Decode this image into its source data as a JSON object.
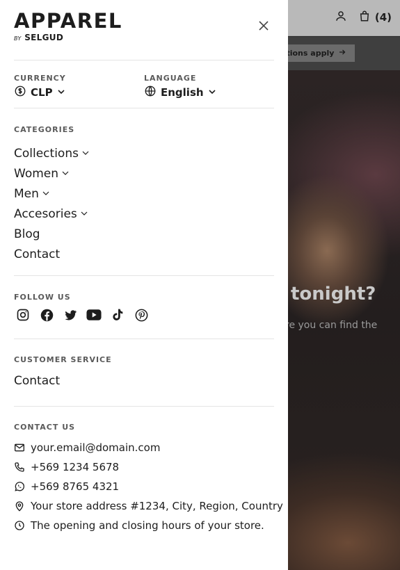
{
  "brand": {
    "name": "APPAREL",
    "by": "BY",
    "sub": "SELGUD"
  },
  "background": {
    "cart_count": "(4)",
    "promo_text": "nditions apply",
    "hero_title": "tonight?",
    "hero_subtitle": "re you can find the"
  },
  "currency": {
    "label": "CURRENCY",
    "value": "CLP",
    "icon": "dollar-circle-icon"
  },
  "language": {
    "label": "LANGUAGE",
    "value": "English",
    "icon": "globe-icon"
  },
  "categories": {
    "label": "CATEGORIES",
    "items": [
      {
        "label": "Collections",
        "has_dropdown": true
      },
      {
        "label": "Women",
        "has_dropdown": true
      },
      {
        "label": "Men",
        "has_dropdown": true
      },
      {
        "label": "Accesories",
        "has_dropdown": true
      },
      {
        "label": "Blog",
        "has_dropdown": false
      },
      {
        "label": "Contact",
        "has_dropdown": false
      }
    ]
  },
  "follow": {
    "label": "FOLLOW US",
    "icons": [
      "instagram-icon",
      "facebook-icon",
      "twitter-icon",
      "youtube-icon",
      "tiktok-icon",
      "pinterest-icon"
    ]
  },
  "customer_service": {
    "label": "CUSTOMER SERVICE",
    "link": "Contact"
  },
  "contact": {
    "label": "CONTACT US",
    "email": "your.email@domain.com",
    "phone": "+569 1234 5678",
    "whatsapp": "+569 8765 4321",
    "address": "Your store address #1234, City, Region, Country",
    "hours": "The opening and closing hours of your store."
  }
}
